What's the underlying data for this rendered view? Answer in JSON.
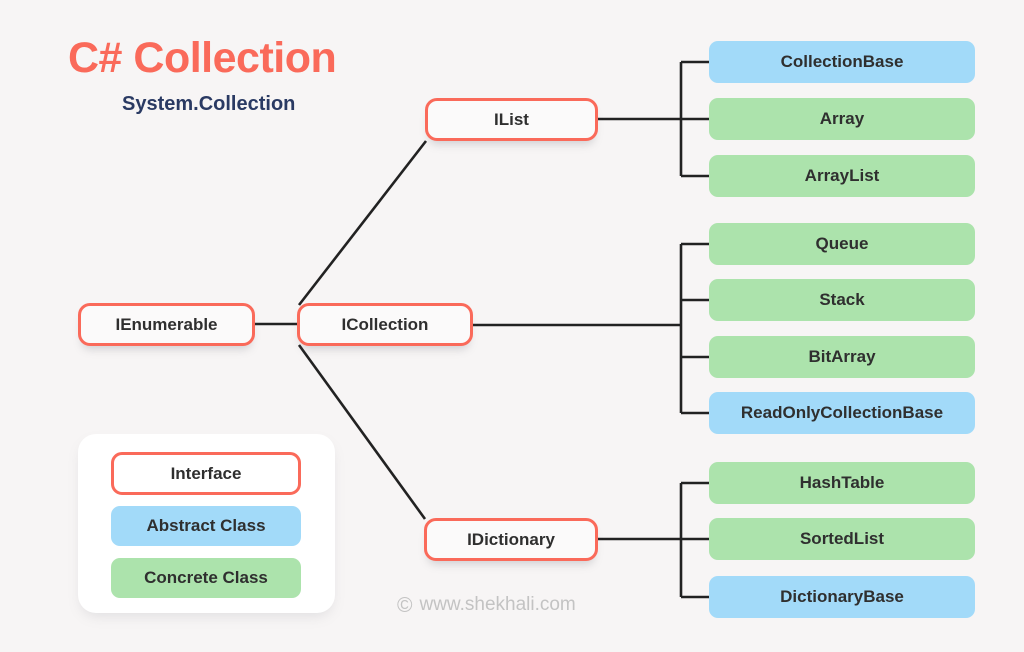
{
  "header": {
    "title": "C# Collection",
    "subtitle": "System.Collection"
  },
  "colors": {
    "background": "#f7f5f5",
    "accent_coral": "#fa6a5a",
    "subtitle_navy": "#2a3a63",
    "abstract_blue": "#a2daf9",
    "concrete_green": "#ace3ac",
    "interface_fill": "#fbfafa",
    "connector_line": "#222222",
    "watermark_gray": "#c3c3c3",
    "node_text": "#2f2f2f"
  },
  "diagram": {
    "root": {
      "label": "IEnumerable",
      "kind": "interface"
    },
    "branches": [
      {
        "label": "IList",
        "kind": "interface",
        "children": [
          {
            "label": "CollectionBase",
            "kind": "abstract"
          },
          {
            "label": "Array",
            "kind": "concrete"
          },
          {
            "label": "ArrayList",
            "kind": "concrete"
          }
        ]
      },
      {
        "label": "ICollection",
        "kind": "interface",
        "children": [
          {
            "label": "Queue",
            "kind": "concrete"
          },
          {
            "label": "Stack",
            "kind": "concrete"
          },
          {
            "label": "BitArray",
            "kind": "concrete"
          },
          {
            "label": "ReadOnlyCollectionBase",
            "kind": "abstract"
          }
        ]
      },
      {
        "label": "IDictionary",
        "kind": "interface",
        "children": [
          {
            "label": "HashTable",
            "kind": "concrete"
          },
          {
            "label": "SortedList",
            "kind": "concrete"
          },
          {
            "label": "DictionaryBase",
            "kind": "abstract"
          }
        ]
      }
    ]
  },
  "legend": {
    "items": [
      {
        "label": "Interface",
        "kind": "interface"
      },
      {
        "label": "Abstract Class",
        "kind": "abstract"
      },
      {
        "label": "Concrete Class",
        "kind": "concrete"
      }
    ]
  },
  "footer": {
    "copyright_symbol": "©",
    "site": "www.shekhali.com"
  }
}
